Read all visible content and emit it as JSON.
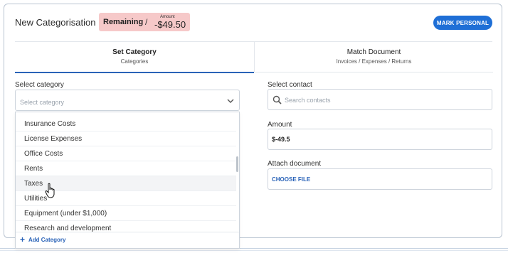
{
  "header": {
    "title": "New Categorisation",
    "remaining_label": "Remaining",
    "separator": "/",
    "amount_caption": "Amount",
    "amount_value": "-$49.50",
    "mark_button": "MARK PERSONAL"
  },
  "tabs": [
    {
      "label": "Set Category",
      "sub": "Categories"
    },
    {
      "label": "Match Document",
      "sub": "Invoices / Expenses / Returns"
    }
  ],
  "category": {
    "label": "Select category",
    "placeholder": "Select category",
    "options": [
      "Insurance Costs",
      "License Expenses",
      "Office Costs",
      "Rents",
      "Taxes",
      "Utilities",
      "Equipment (under $1,000)",
      "Research and development"
    ],
    "add_label": "Add Category"
  },
  "contact": {
    "label": "Select contact",
    "placeholder": "Search contacts"
  },
  "amount": {
    "label": "Amount",
    "value": "$-49.5"
  },
  "attach": {
    "label": "Attach document",
    "button": "CHOOSE FILE"
  },
  "colors": {
    "accent": "#1f6fd6",
    "remaining_bg": "#f6c9c9"
  }
}
